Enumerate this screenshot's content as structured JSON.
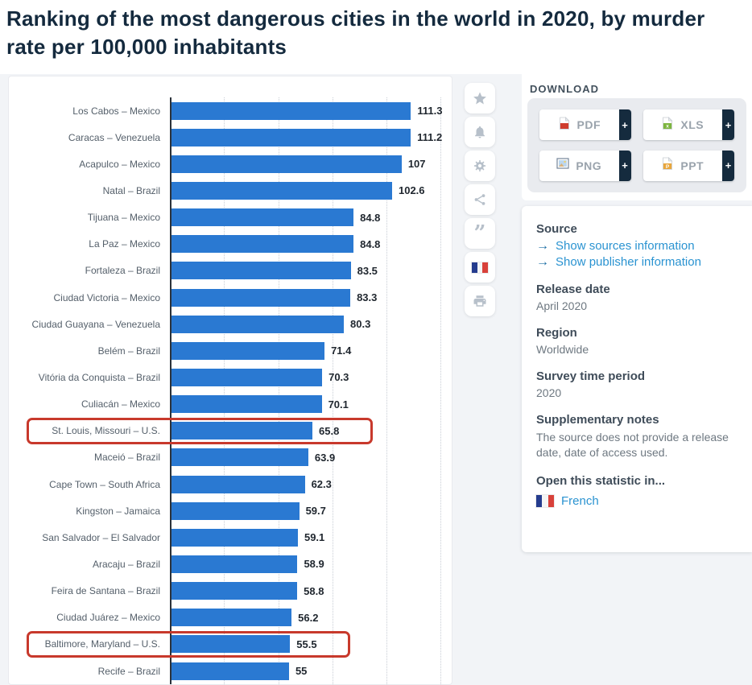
{
  "header": {
    "title": "Ranking of the most dangerous cities in the world in 2020, by murder rate per 100,000 inhabitants"
  },
  "chart_data": {
    "type": "bar",
    "orientation": "horizontal",
    "title": "Ranking of the most dangerous cities in the world in 2020, by murder rate per 100,000 inhabitants",
    "xlabel": "Murder rate per 100,000 inhabitants",
    "ylabel": "",
    "xlim": [
      0,
      129
    ],
    "gridline_interval": 25,
    "grid": true,
    "bar_color": "#2a79d2",
    "highlight_box_color": "#c8392c",
    "categories": [
      "Los Cabos – Mexico",
      "Caracas – Venezuela",
      "Acapulco – Mexico",
      "Natal – Brazil",
      "Tijuana – Mexico",
      "La Paz – Mexico",
      "Fortaleza – Brazil",
      "Ciudad Victoria – Mexico",
      "Ciudad Guayana – Venezuela",
      "Belém – Brazil",
      "Vitória da Conquista – Brazil",
      "Culiacán – Mexico",
      "St. Louis, Missouri – U.S.",
      "Maceió – Brazil",
      "Cape Town – South Africa",
      "Kingston – Jamaica",
      "San Salvador – El Salvador",
      "Aracaju – Brazil",
      "Feira de Santana – Brazil",
      "Ciudad Juárez – Mexico",
      "Baltimore, Maryland – U.S.",
      "Recife – Brazil"
    ],
    "values": [
      111.3,
      111.2,
      107,
      102.6,
      84.8,
      84.8,
      83.5,
      83.3,
      80.3,
      71.4,
      70.3,
      70.1,
      65.8,
      63.9,
      62.3,
      59.7,
      59.1,
      58.9,
      58.8,
      56.2,
      55.5,
      55
    ],
    "value_labels": [
      "111.3",
      "111.2",
      "107",
      "102.6",
      "84.8",
      "84.8",
      "83.5",
      "83.3",
      "80.3",
      "71.4",
      "70.3",
      "70.1",
      "65.8",
      "63.9",
      "62.3",
      "59.7",
      "59.1",
      "58.9",
      "58.8",
      "56.2",
      "55.5",
      "55"
    ],
    "highlighted_categories": [
      "St. Louis, Missouri – U.S.",
      "Baltimore, Maryland – U.S."
    ]
  },
  "toolbar": {
    "items": [
      "favorite",
      "alert",
      "settings",
      "share",
      "cite",
      "french-version",
      "print"
    ],
    "quote_glyph": "”"
  },
  "download": {
    "label": "DOWNLOAD",
    "plus_label": "+",
    "buttons": [
      {
        "label": "PDF"
      },
      {
        "label": "XLS"
      },
      {
        "label": "PNG"
      },
      {
        "label": "PPT"
      }
    ]
  },
  "sidebar": {
    "source_heading": "Source",
    "link_arrow": "→",
    "links": [
      {
        "label": "Show sources information"
      },
      {
        "label": "Show publisher information"
      }
    ],
    "release_date_heading": "Release date",
    "release_date": "April 2020",
    "region_heading": "Region",
    "region": "Worldwide",
    "survey_heading": "Survey time period",
    "survey_period": "2020",
    "notes_heading": "Supplementary notes",
    "notes": "The source does not provide a release date, date of access used.",
    "open_heading": "Open this statistic in...",
    "language_link": "French"
  }
}
